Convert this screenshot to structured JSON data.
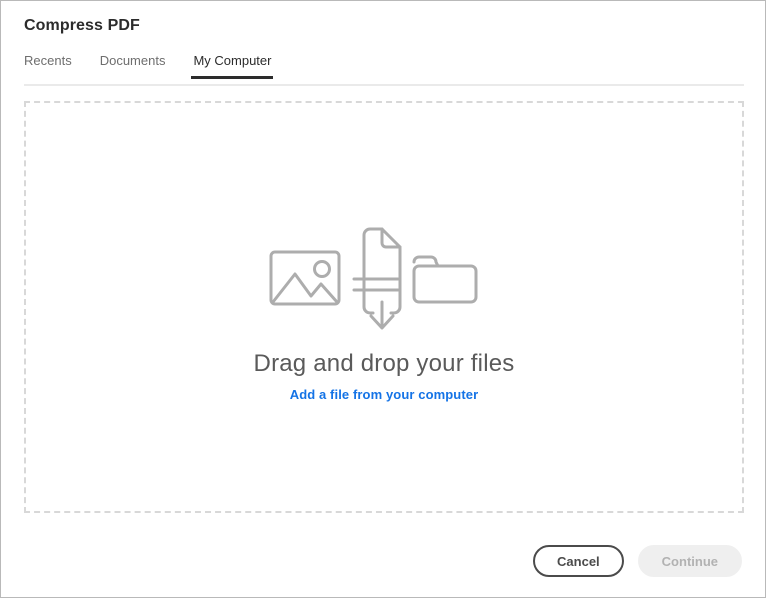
{
  "window": {
    "title": "Compress PDF"
  },
  "tabs": [
    {
      "label": "Recents",
      "active": false
    },
    {
      "label": "Documents",
      "active": false
    },
    {
      "label": "My Computer",
      "active": true
    }
  ],
  "dropzone": {
    "heading": "Drag and drop your files",
    "link_label": "Add a file from your computer",
    "icons": [
      "image-icon",
      "document-download-icon",
      "folder-icon"
    ]
  },
  "footer": {
    "cancel_label": "Cancel",
    "continue_label": "Continue",
    "continue_disabled": true
  },
  "colors": {
    "accent_link": "#1473e6",
    "tab_active": "#2c2c2c",
    "tab_inactive": "#6e6e6e",
    "icon_stroke": "#adadad",
    "dashed_border": "#d8d8d8",
    "cancel_border": "#4b4b4b",
    "continue_bg": "#efefef",
    "continue_text": "#b2b2b2"
  }
}
